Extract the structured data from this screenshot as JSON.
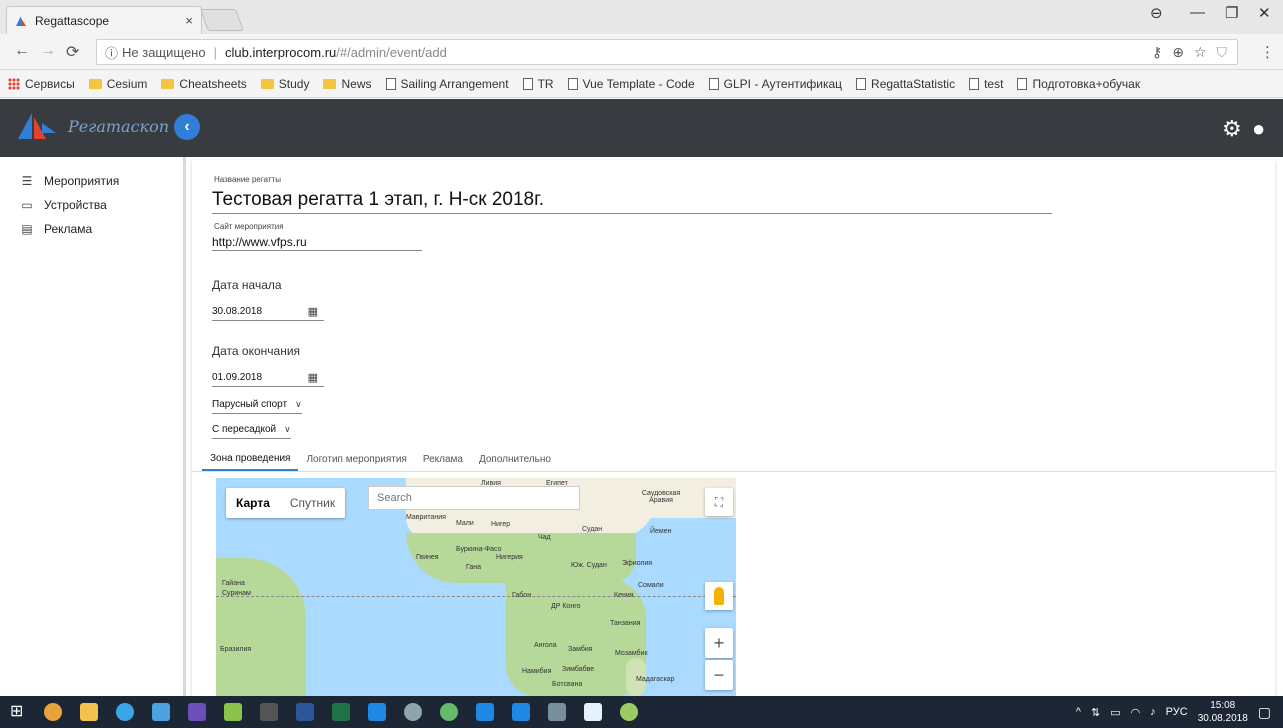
{
  "browser": {
    "tab_title": "Regattascope",
    "tab_close": "×",
    "security": "Не защищено",
    "url_host": "club.interprocom.ru",
    "url_path": "/#/admin/event/add",
    "bookmarks": [
      {
        "label": "Сервисы",
        "kind": "apps"
      },
      {
        "label": "Cesium",
        "kind": "folder"
      },
      {
        "label": "Cheatsheets",
        "kind": "folder"
      },
      {
        "label": "Study",
        "kind": "folder"
      },
      {
        "label": "News",
        "kind": "folder"
      },
      {
        "label": "Sailing Arrangement",
        "kind": "page"
      },
      {
        "label": "TR",
        "kind": "page"
      },
      {
        "label": "Vue Template - Code",
        "kind": "page"
      },
      {
        "label": "GLPI - Аутентификац",
        "kind": "page"
      },
      {
        "label": "RegattaStatistic",
        "kind": "page"
      },
      {
        "label": "test",
        "kind": "page"
      },
      {
        "label": "Подготовка+обучак",
        "kind": "page"
      }
    ]
  },
  "app": {
    "brand": "Регатаскоп",
    "brand_color": "#7fa0c8",
    "header_color": "#383b40",
    "accent": "#2f7fd9"
  },
  "sidebar": {
    "items": [
      {
        "label": "Мероприятия",
        "icon": "list-icon"
      },
      {
        "label": "Устройства",
        "icon": "monitor-icon"
      },
      {
        "label": "Реклама",
        "icon": "newspaper-icon"
      }
    ]
  },
  "form": {
    "name_label": "Название регатты",
    "name_value": "Тестовая регатта 1 этап, г. Н-ск 2018г.",
    "site_label": "Сайт мероприятия",
    "site_value": "http://www.vfps.ru",
    "start_heading": "Дата начала",
    "start_date": "30.08.2018",
    "end_heading": "Дата окончания",
    "end_date": "01.09.2018",
    "sport": "Парусный спорт",
    "transfer": "С пересадкой",
    "tabs": [
      "Зона проведения",
      "Логотип мероприятия",
      "Реклама",
      "Дополнительно"
    ]
  },
  "map": {
    "type_map": "Карта",
    "type_satellite": "Спутник",
    "search_placeholder": "Search",
    "zoom_in": "+",
    "zoom_out": "−",
    "labels": {
      "egypt": "Египет",
      "libya": "Ливия",
      "saudi": "Саудовская Аравия",
      "mauritania": "Мавритания",
      "mali": "Мали",
      "niger": "Нигер",
      "chad": "Чад",
      "sudan": "Судан",
      "yemen": "Йемен",
      "burkina": "Буркина-Фасо",
      "nigeria": "Нигерия",
      "guinea": "Гвинея",
      "ghana": "Гана",
      "south_sudan": "Юж. Судан",
      "ethiopia": "Эфиопия",
      "somalia": "Сомали",
      "kenya": "Кения",
      "gabon": "Габон",
      "drc": "ДР Конго",
      "tanzania": "Танзания",
      "angola": "Ангола",
      "zambia": "Замбия",
      "mozambique": "Мозамбик",
      "namibia": "Намибия",
      "zimbabwe": "Зимбабве",
      "botswana": "Ботсвана",
      "madagascar": "Мадагаскар",
      "brazil": "Бразилия",
      "suriname": "Суринам",
      "guyana": "Гайана"
    }
  },
  "taskbar": {
    "lang": "РУС",
    "time": "15:08",
    "date": "30.08.2018"
  }
}
